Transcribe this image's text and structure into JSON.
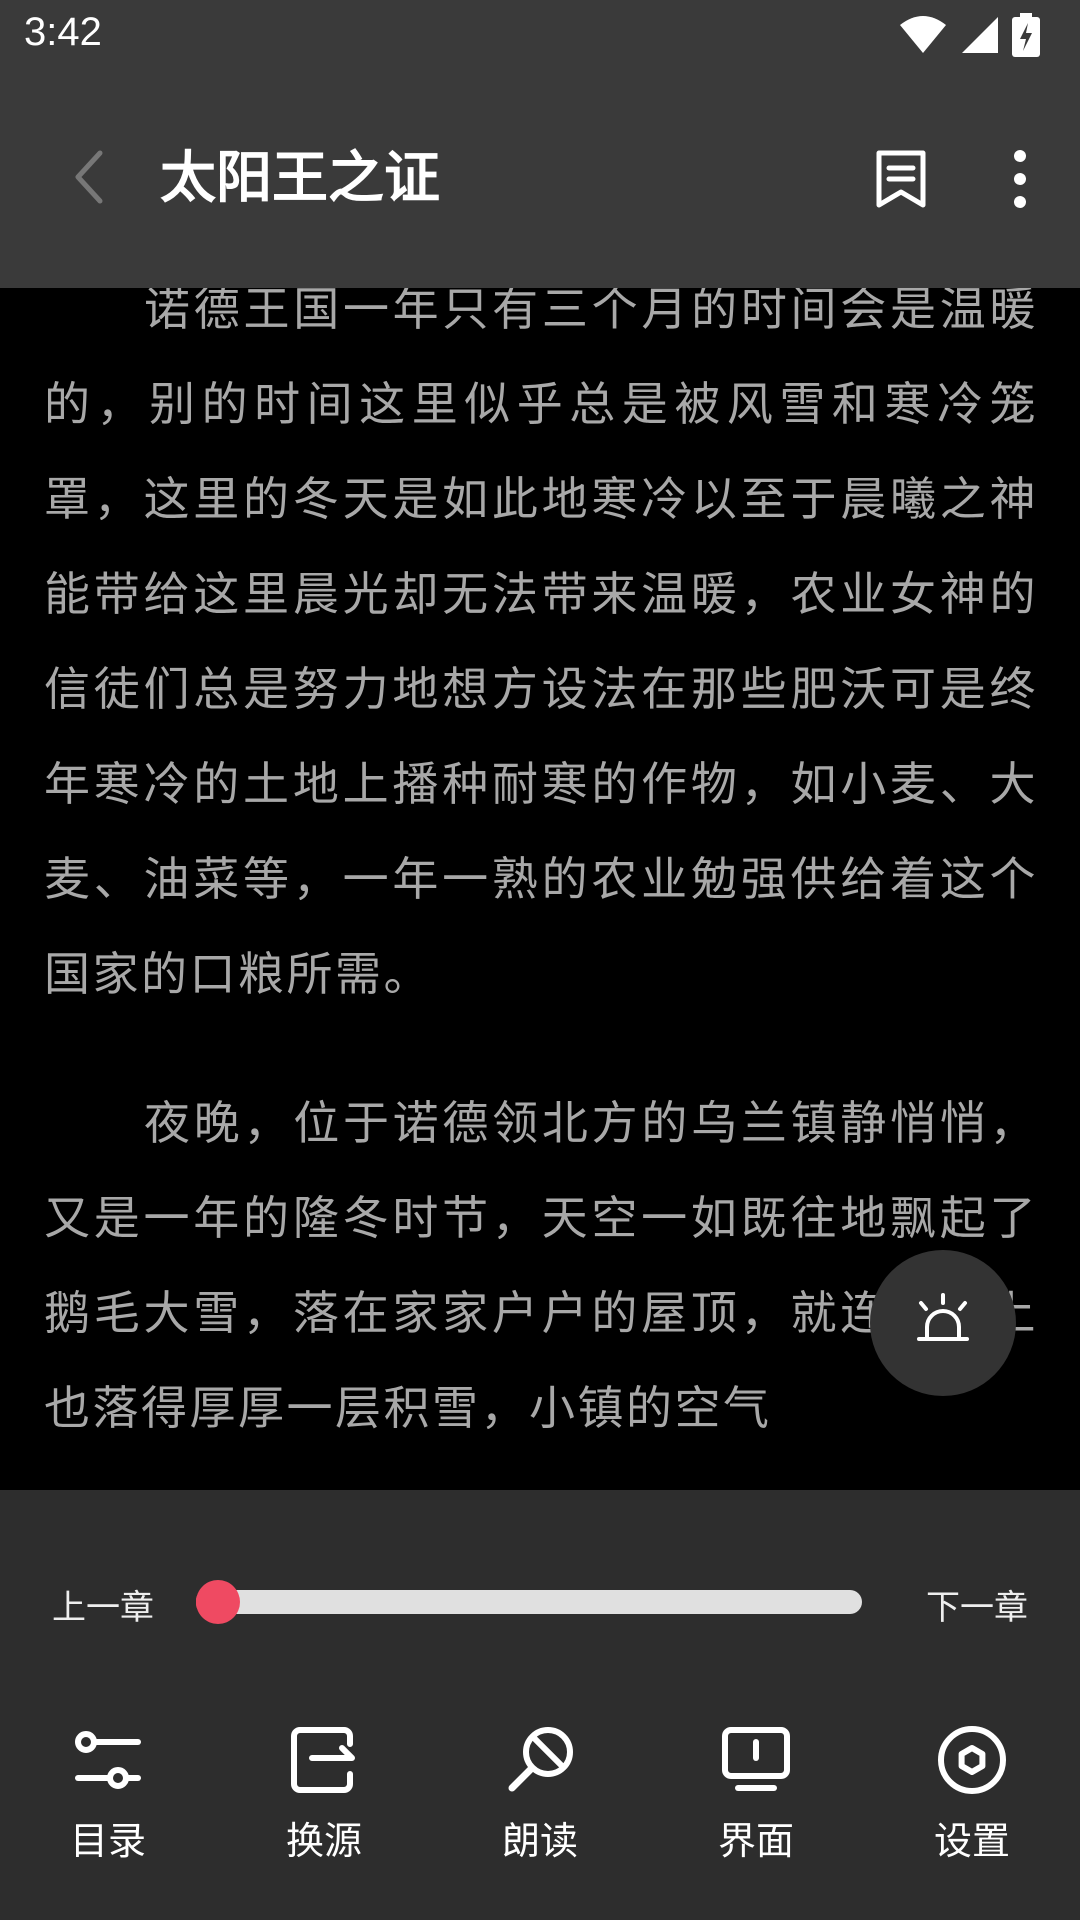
{
  "status_bar": {
    "time": "3:42"
  },
  "header": {
    "title": "太阳王之证",
    "icons": [
      "back-arrow-icon",
      "bookmark-icon",
      "more-vert-icon"
    ]
  },
  "content": {
    "paragraphs": [
      "诺德王国一年只有三个月的时间会是温暖的，别的时间这里似乎总是被风雪和寒冷笼罩，这里的冬天是如此地寒冷以至于晨曦之神能带给这里晨光却无法带来温暖，农业女神的信徒们总是努力地想方设法在那些肥沃可是终年寒冷的土地上播种耐寒的作物，如小麦、大麦、油菜等，一年一熟的农业勉强供给着这个国家的口粮所需。",
      "夜晚，位于诺德领北方的乌兰镇静悄悄，又是一年的隆冬时节，天空一如既往地飘起了鹅毛大雪，落在家家户户的屋顶，就连道路上也落得厚厚一层积雪，小镇的空气"
    ]
  },
  "progress": {
    "prev_label": "上一章",
    "next_label": "下一章",
    "fraction": 0.03
  },
  "toolbar": {
    "items": [
      {
        "label": "目录",
        "icon": "catalog-icon"
      },
      {
        "label": "换源",
        "icon": "switch-source-icon"
      },
      {
        "label": "朗读",
        "icon": "read-aloud-icon"
      },
      {
        "label": "界面",
        "icon": "display-icon"
      },
      {
        "label": "设置",
        "icon": "settings-icon"
      }
    ]
  },
  "colors": {
    "accent": "#ef4a62",
    "bar_bg": "#3a3a3a",
    "panel_bg": "#2d2d2d",
    "text": "#a8a8a8"
  }
}
